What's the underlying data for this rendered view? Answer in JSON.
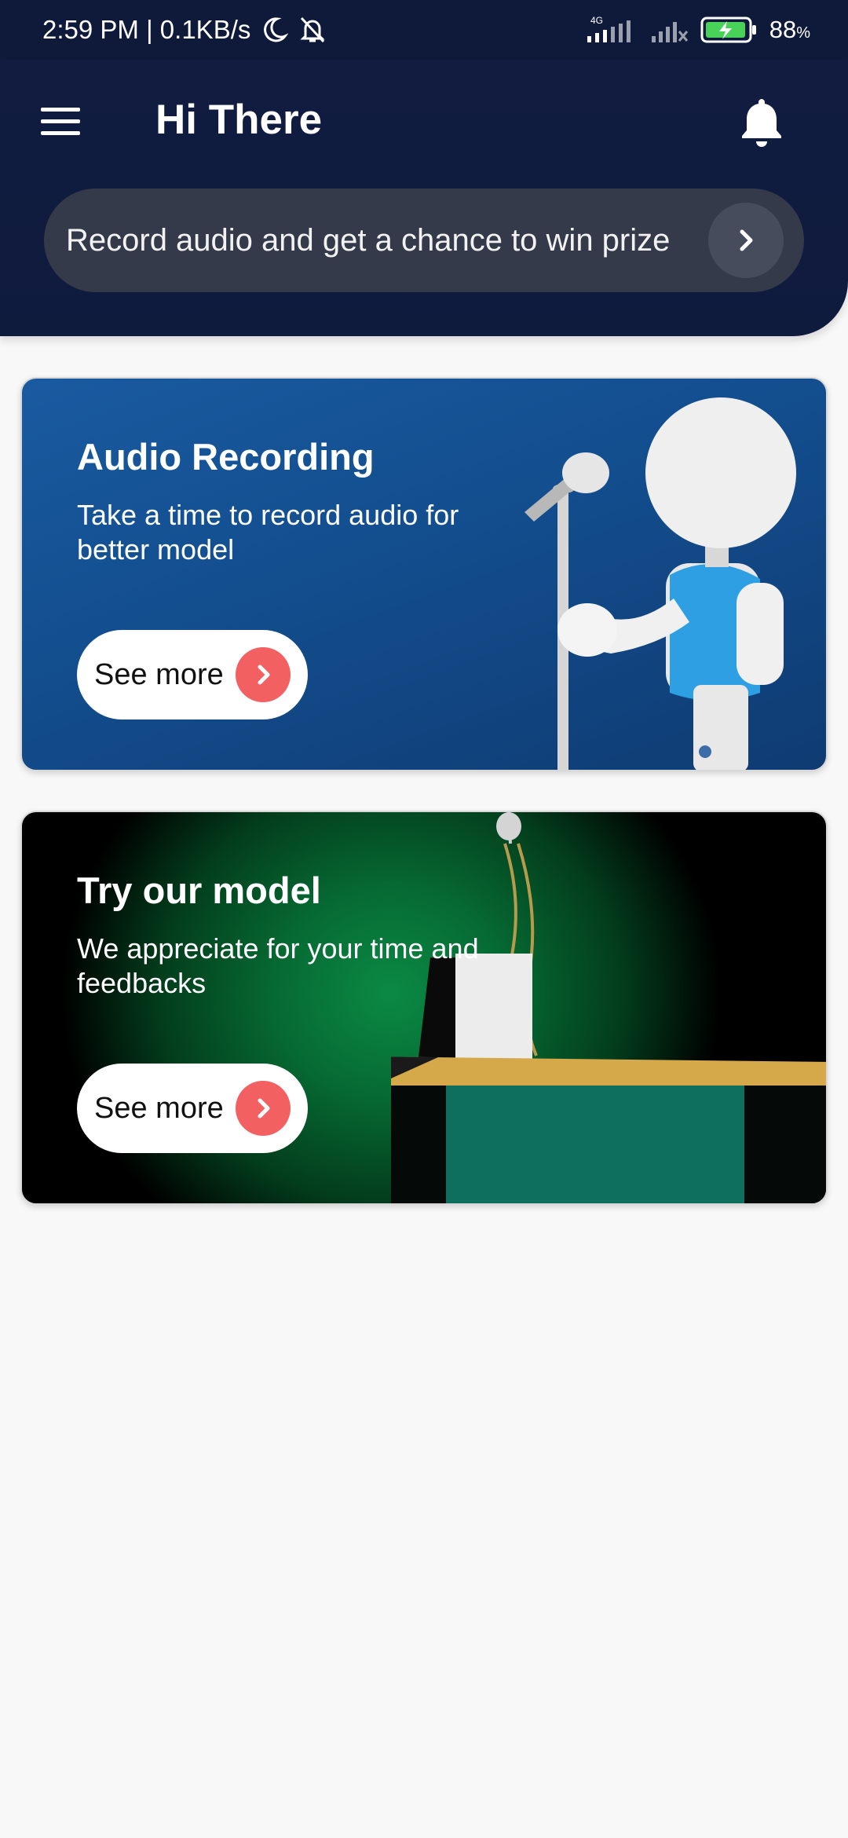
{
  "status_bar": {
    "time_speed": "2:59 PM | 0.1KB/s",
    "network_type": "4G",
    "battery_percent": "88",
    "battery_unit": "%",
    "icons": [
      "moon-icon",
      "bell-off-icon",
      "signal-icon",
      "signal-off-icon",
      "battery-charging-icon"
    ]
  },
  "header": {
    "greeting": "Hi There",
    "menu_icon": "hamburger-menu-icon",
    "notification_icon": "bell-icon"
  },
  "banner": {
    "text": "Record audio and get a chance to win prize",
    "arrow_icon": "chevron-right-icon"
  },
  "cards": [
    {
      "title": "Audio Recording",
      "description": "Take a time to record audio for better model",
      "button_label": "See more",
      "button_icon": "chevron-right-icon",
      "image": "robot-microphone-illustration"
    },
    {
      "title": "Try our model",
      "description": "We appreciate for your time and feedbacks",
      "button_label": "See more",
      "button_icon": "chevron-right-icon",
      "image": "podium-microphone-illustration"
    }
  ],
  "colors": {
    "header_bg": "#111c40",
    "banner_bg": "#353a4a",
    "card1_bg": "#1a5aa0",
    "card2_bg": "#0b8a44",
    "accent_red": "#f26062",
    "page_bg": "#f8f8f8"
  }
}
